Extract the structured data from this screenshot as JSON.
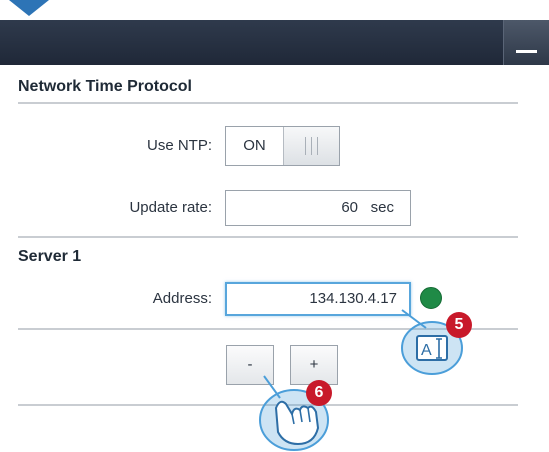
{
  "titlebar": {
    "minimize_icon": "minus-icon"
  },
  "ntp": {
    "title": "Network Time Protocol",
    "use_ntp_label": "Use NTP:",
    "use_ntp_value": "ON",
    "update_rate_label": "Update rate:",
    "update_rate_value": "60",
    "update_rate_unit": "sec"
  },
  "server1": {
    "title": "Server 1",
    "address_label": "Address:",
    "address_value": "134.130.4.17",
    "status_color": "#1f8a46",
    "minus_label": "-",
    "plus_label": "+"
  },
  "annotations": {
    "step5": "5",
    "step6": "6",
    "step5_icon": "keyboard-text-input-icon",
    "step6_icon": "touch-tap-icon"
  },
  "colors": {
    "titlebar": "#242e3f",
    "focus_border": "#58a6dc",
    "callout": "#c8192a",
    "gesture": "#4b9ed9"
  }
}
